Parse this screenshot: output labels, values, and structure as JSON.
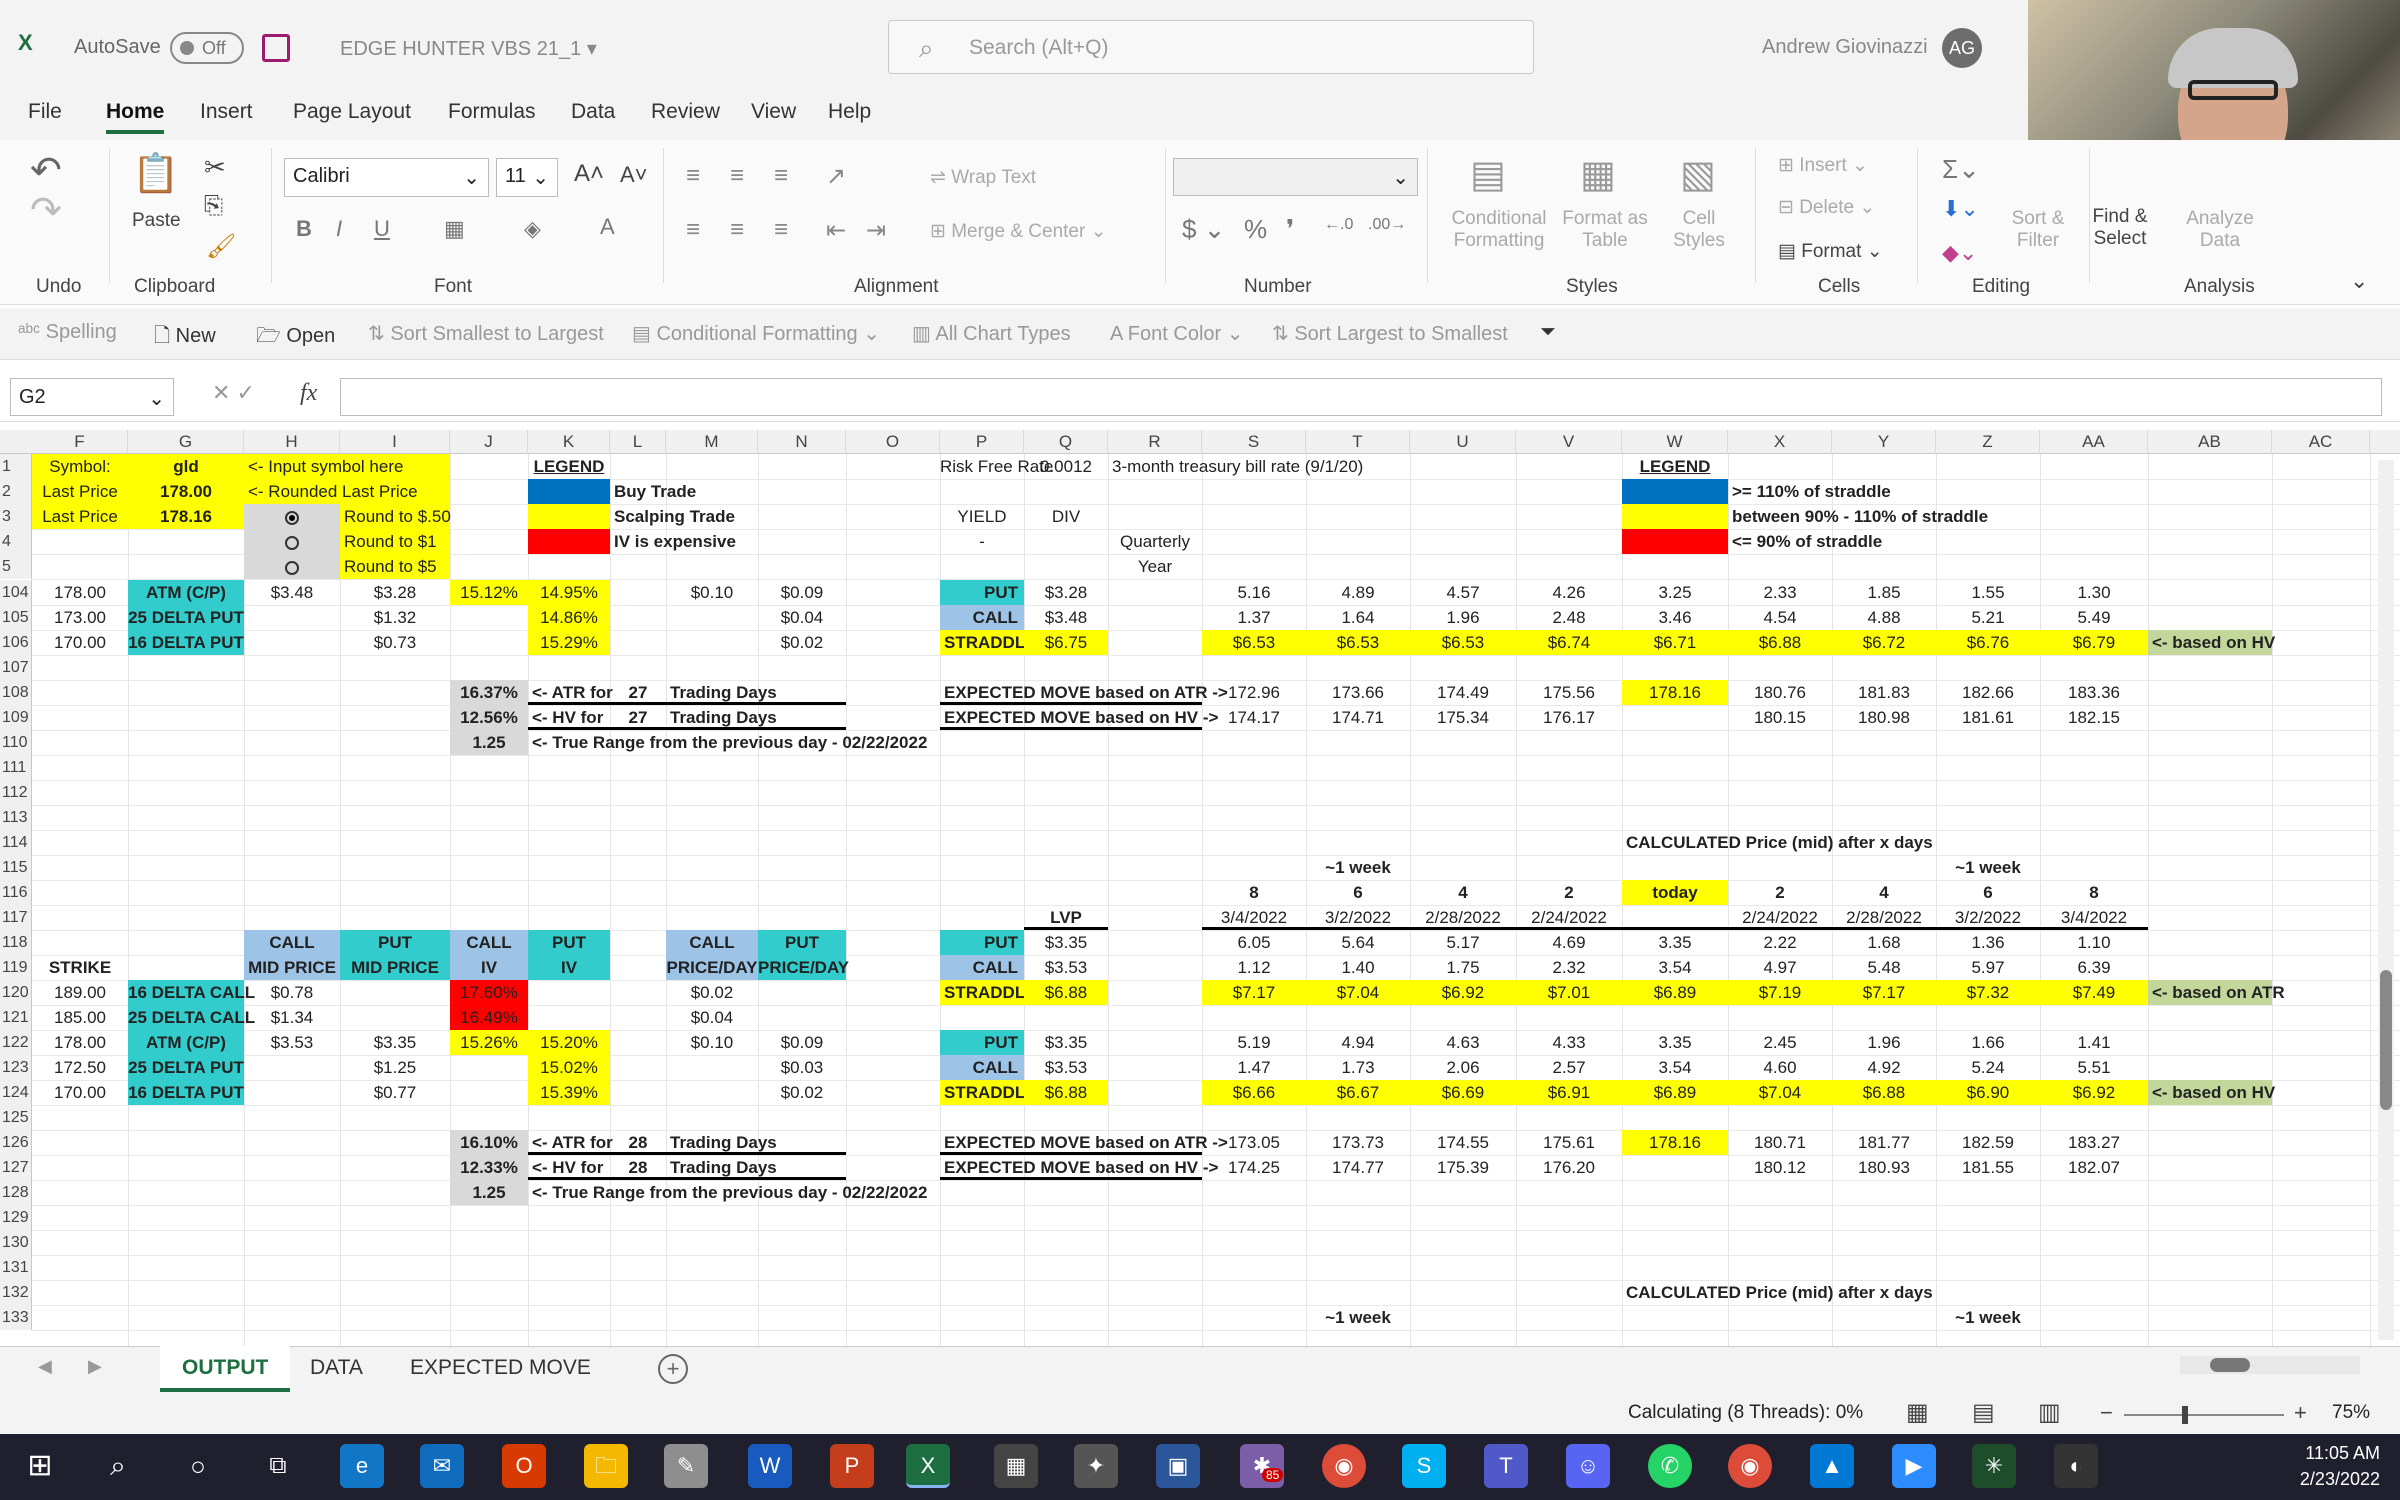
{
  "titlebar": {
    "app_icon": "X",
    "autosave": "AutoSave",
    "toggle": "Off",
    "doc_title": "EDGE HUNTER VBS 21_1",
    "search_placeholder": "Search (Alt+Q)",
    "user": "Andrew Giovinazzi",
    "initials": "AG"
  },
  "menu": [
    "File",
    "Home",
    "Insert",
    "Page Layout",
    "Formulas",
    "Data",
    "Review",
    "View",
    "Help"
  ],
  "ribbon": {
    "undo": "Undo",
    "clipboard": "Clipboard",
    "paste": "Paste",
    "font_group": "Font",
    "font": "Calibri",
    "font_size": "11",
    "alignment": "Alignment",
    "wrap": "Wrap Text",
    "merge": "Merge & Center",
    "number": "Number",
    "cond_fmt": "Conditional Formatting",
    "format_table": "Format as Table",
    "cell_styles": "Cell Styles",
    "styles": "Styles",
    "insert": "Insert",
    "delete": "Delete",
    "format": "Format",
    "cells": "Cells",
    "sort": "Sort & Filter",
    "find": "Find & Select",
    "editing": "Editing",
    "analyze": "Analyze Data",
    "analysis": "Analysis"
  },
  "qat": [
    "Spelling",
    "New",
    "Open",
    "Sort Smallest to Largest",
    "Conditional Formatting",
    "All Chart Types",
    "Font Color",
    "Sort Largest to Smallest"
  ],
  "namebox": "G2",
  "columns": [
    "F",
    "G",
    "H",
    "I",
    "J",
    "K",
    "L",
    "M",
    "N",
    "O",
    "P",
    "Q",
    "R",
    "S",
    "T",
    "U",
    "V",
    "W",
    "X",
    "Y",
    "Z",
    "AA",
    "AB",
    "AC"
  ],
  "rows": [
    "1",
    "2",
    "3",
    "4",
    "5",
    "104",
    "105",
    "106",
    "107",
    "108",
    "109",
    "110",
    "111",
    "112",
    "113",
    "114",
    "115",
    "116",
    "117",
    "118",
    "119",
    "120",
    "121",
    "122",
    "123",
    "124",
    "125",
    "126",
    "127",
    "128",
    "129",
    "130",
    "131",
    "132",
    "133"
  ],
  "cells": {
    "symbol_lbl": "Symbol:",
    "symbol": "gld",
    "input_hint": "<- Input symbol here",
    "legend": "LEGEND",
    "last_price_lbl": "Last Price",
    "last_price_1": "178.00",
    "rounded_hint": "<- Rounded Last Price",
    "buy_trade": "Buy Trade",
    "last_price_2": "178.16",
    "r050": "Round to $.50",
    "scalp": "Scalping Trade",
    "r1": "Round to $1",
    "iv_exp": "IV is expensive",
    "r5": "Round to $5",
    "rfr_lbl": "Risk Free Rate",
    "rfr": "0.0012",
    "rfr_note": "3-month treasury bill rate (9/1/20)",
    "yield": "YIELD",
    "div": "DIV",
    "dash": "-",
    "quarterly": "Quarterly",
    "year": "Year",
    "legend2": "LEGEND",
    "l_gt": ">= 110% of straddle",
    "l_btw": "between 90% - 110% of straddle",
    "l_lt": "<= 90% of straddle",
    "r104": [
      "178.00",
      "ATM (C/P)",
      "$3.48",
      "$3.28",
      "15.12%",
      "14.95%",
      "$0.10",
      "$0.09",
      "PUT",
      "$3.28",
      "5.16",
      "4.89",
      "4.57",
      "4.26",
      "3.25",
      "2.33",
      "1.85",
      "1.55",
      "1.30"
    ],
    "r105": [
      "173.00",
      "25 DELTA PUT",
      "$1.32",
      "14.86%",
      "$0.04",
      "CALL",
      "$3.48",
      "1.37",
      "1.64",
      "1.96",
      "2.48",
      "3.46",
      "4.54",
      "4.88",
      "5.21",
      "5.49"
    ],
    "r106": [
      "170.00",
      "16 DELTA PUT",
      "$0.73",
      "15.29%",
      "$0.02",
      "STRADDLE",
      "$6.75",
      "$6.53",
      "$6.53",
      "$6.53",
      "$6.74",
      "$6.71",
      "$6.88",
      "$6.72",
      "$6.76",
      "$6.79",
      "<- based on HV"
    ],
    "r108": [
      "16.37%",
      "<- ATR for",
      "27",
      "Trading Days",
      "EXPECTED MOVE based on ATR ->",
      "172.96",
      "173.66",
      "174.49",
      "175.56",
      "178.16",
      "180.76",
      "181.83",
      "182.66",
      "183.36"
    ],
    "r109": [
      "12.56%",
      "<- HV for",
      "27",
      "Trading Days",
      "EXPECTED MOVE based on HV ->",
      "174.17",
      "174.71",
      "175.34",
      "176.17",
      "180.15",
      "180.98",
      "181.61",
      "182.15"
    ],
    "r110": [
      "1.25",
      "<- True Range from the previous day - 02/22/2022"
    ],
    "calc_title": "CALCULATED Price (mid) after x days",
    "week": "~1 week",
    "days": [
      "8",
      "6",
      "4",
      "2",
      "today",
      "2",
      "4",
      "6",
      "8"
    ],
    "dates": [
      "3/4/2022",
      "3/2/2022",
      "2/28/2022",
      "2/24/2022",
      "2/24/2022",
      "2/28/2022",
      "3/2/2022",
      "3/4/2022"
    ],
    "lvp": "LVP",
    "hdr": [
      "CALL",
      "PUT",
      "CALL",
      "PUT",
      "CALL",
      "PUT",
      "MID PRICE",
      "MID PRICE",
      "IV",
      "IV",
      "PRICE/DAY",
      "PRICE/DAY"
    ],
    "strike": "STRIKE",
    "r118": [
      "PUT",
      "$3.35",
      "6.05",
      "5.64",
      "5.17",
      "4.69",
      "3.35",
      "2.22",
      "1.68",
      "1.36",
      "1.10"
    ],
    "r119": [
      "CALL",
      "$3.53",
      "1.12",
      "1.40",
      "1.75",
      "2.32",
      "3.54",
      "4.97",
      "5.48",
      "5.97",
      "6.39"
    ],
    "r120": [
      "189.00",
      "16 DELTA CALL",
      "$0.78",
      "17.60%",
      "$0.02",
      "STRADDLE",
      "$6.88",
      "$7.17",
      "$7.04",
      "$6.92",
      "$7.01",
      "$6.89",
      "$7.19",
      "$7.17",
      "$7.32",
      "$7.49",
      "<- based on ATR"
    ],
    "r121": [
      "185.00",
      "25 DELTA CALL",
      "$1.34",
      "16.49%",
      "$0.04"
    ],
    "r122": [
      "178.00",
      "ATM (C/P)",
      "$3.53",
      "$3.35",
      "15.26%",
      "15.20%",
      "$0.10",
      "$0.09",
      "PUT",
      "$3.35",
      "5.19",
      "4.94",
      "4.63",
      "4.33",
      "3.35",
      "2.45",
      "1.96",
      "1.66",
      "1.41"
    ],
    "r123": [
      "172.50",
      "25 DELTA PUT",
      "$1.25",
      "15.02%",
      "$0.03",
      "CALL",
      "$3.53",
      "1.47",
      "1.73",
      "2.06",
      "2.57",
      "3.54",
      "4.60",
      "4.92",
      "5.24",
      "5.51"
    ],
    "r124": [
      "170.00",
      "16 DELTA PUT",
      "$0.77",
      "15.39%",
      "$0.02",
      "STRADDLE",
      "$6.88",
      "$6.66",
      "$6.67",
      "$6.69",
      "$6.91",
      "$6.89",
      "$7.04",
      "$6.88",
      "$6.90",
      "$6.92",
      "<- based on HV"
    ],
    "r126": [
      "16.10%",
      "<- ATR for",
      "28",
      "Trading Days",
      "EXPECTED MOVE based on ATR ->",
      "173.05",
      "173.73",
      "174.55",
      "175.61",
      "178.16",
      "180.71",
      "181.77",
      "182.59",
      "183.27"
    ],
    "r127": [
      "12.33%",
      "<- HV for",
      "28",
      "Trading Days",
      "EXPECTED MOVE based on HV ->",
      "174.25",
      "174.77",
      "175.39",
      "176.20",
      "180.12",
      "180.93",
      "181.55",
      "182.07"
    ],
    "r128": [
      "1.25",
      "<- True Range from the previous day - 02/22/2022"
    ]
  },
  "sheets": [
    "OUTPUT",
    "DATA",
    "EXPECTED MOVE"
  ],
  "status": {
    "calc": "Calculating (8 Threads): 0%",
    "zoom": "75%"
  },
  "clock": {
    "time": "11:05 AM",
    "date": "2/23/2022"
  },
  "taskbar_badge": "85",
  "colors": {
    "excel_green": "#1d6f42",
    "yellow": "#ffff00",
    "blue": "#0070c0",
    "red": "#ff0000",
    "teal": "#33cccc"
  }
}
